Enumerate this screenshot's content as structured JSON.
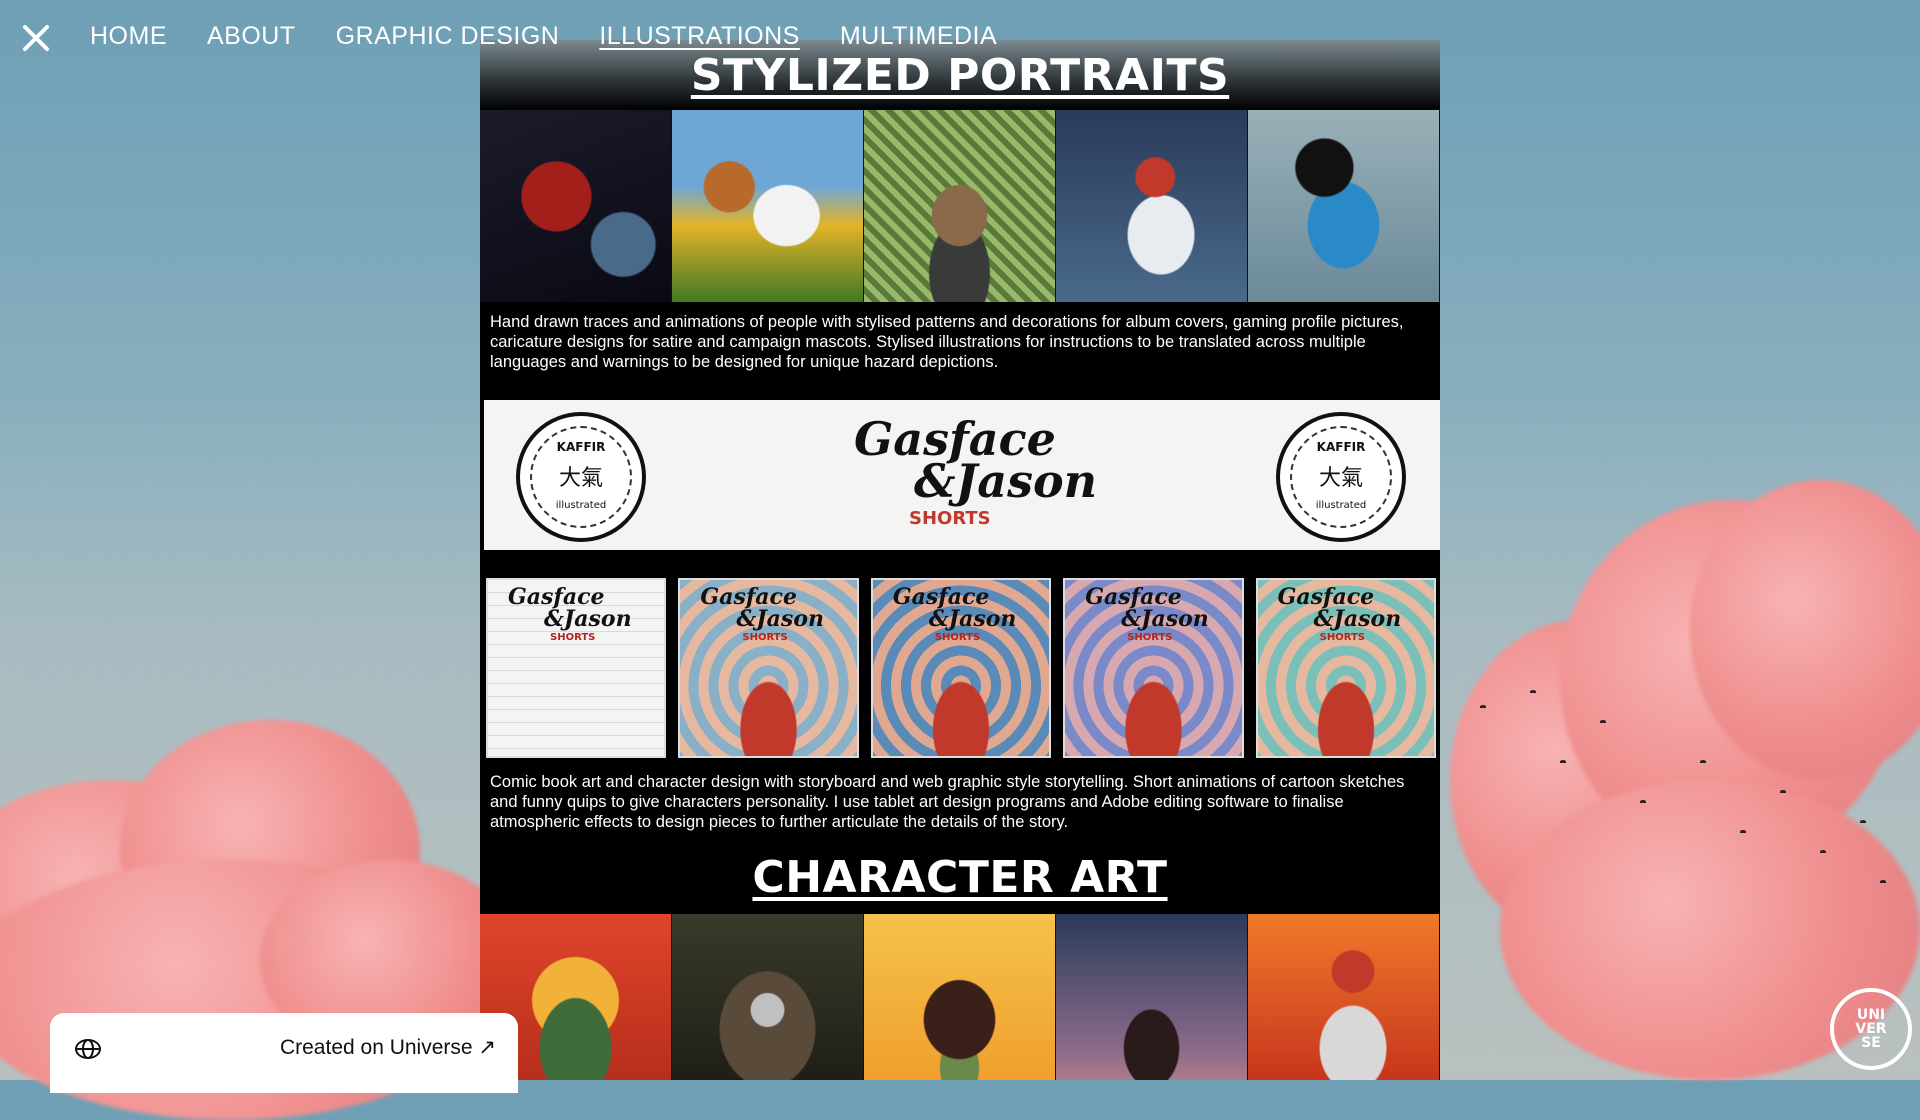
{
  "nav": {
    "close_icon": "close-icon",
    "links": [
      "HOME",
      "ABOUT",
      "GRAPHIC DESIGN",
      "ILLUSTRATIONS",
      "MULTIMEDIA"
    ],
    "active": "ILLUSTRATIONS"
  },
  "sections": {
    "portraits": {
      "title": "STYLIZED PORTRAITS",
      "description": "Hand drawn traces and animations of people with stylised patterns and decorations for album covers, gaming profile pictures, caricature designs for satire and campaign mascots. Stylised illustrations for instructions to be translated across multiple languages and warnings to be designed for unique hazard depictions."
    },
    "banner": {
      "seal_line1": "KAFFIR",
      "seal_line2": "大氣",
      "seal_line3": "illustrated",
      "title_line1": "Gasface",
      "title_line2": "&Jason",
      "subtitle": "SHORTS"
    },
    "comics": {
      "thumb_title_line1": "Gasface",
      "thumb_title_line2": "&Jason",
      "thumb_subtitle": "SHORTS",
      "description": "Comic book art and character design with storyboard and web graphic style storytelling. Short animations of cartoon sketches and funny quips to give characters personality. I use tablet art design programs and Adobe editing software to finalise atmospheric effects to design pieces to further articulate the details of the story."
    },
    "character": {
      "title": "CHARACTER ART"
    }
  },
  "footer": {
    "created_label": "Created on Universe ↗",
    "globe_icon": "globe-icon",
    "logo_text": "UNI VER SE"
  },
  "colors": {
    "column_bg": "#000000",
    "cloud_pink": "#f08e8e",
    "sky": "#6e9fb5"
  }
}
